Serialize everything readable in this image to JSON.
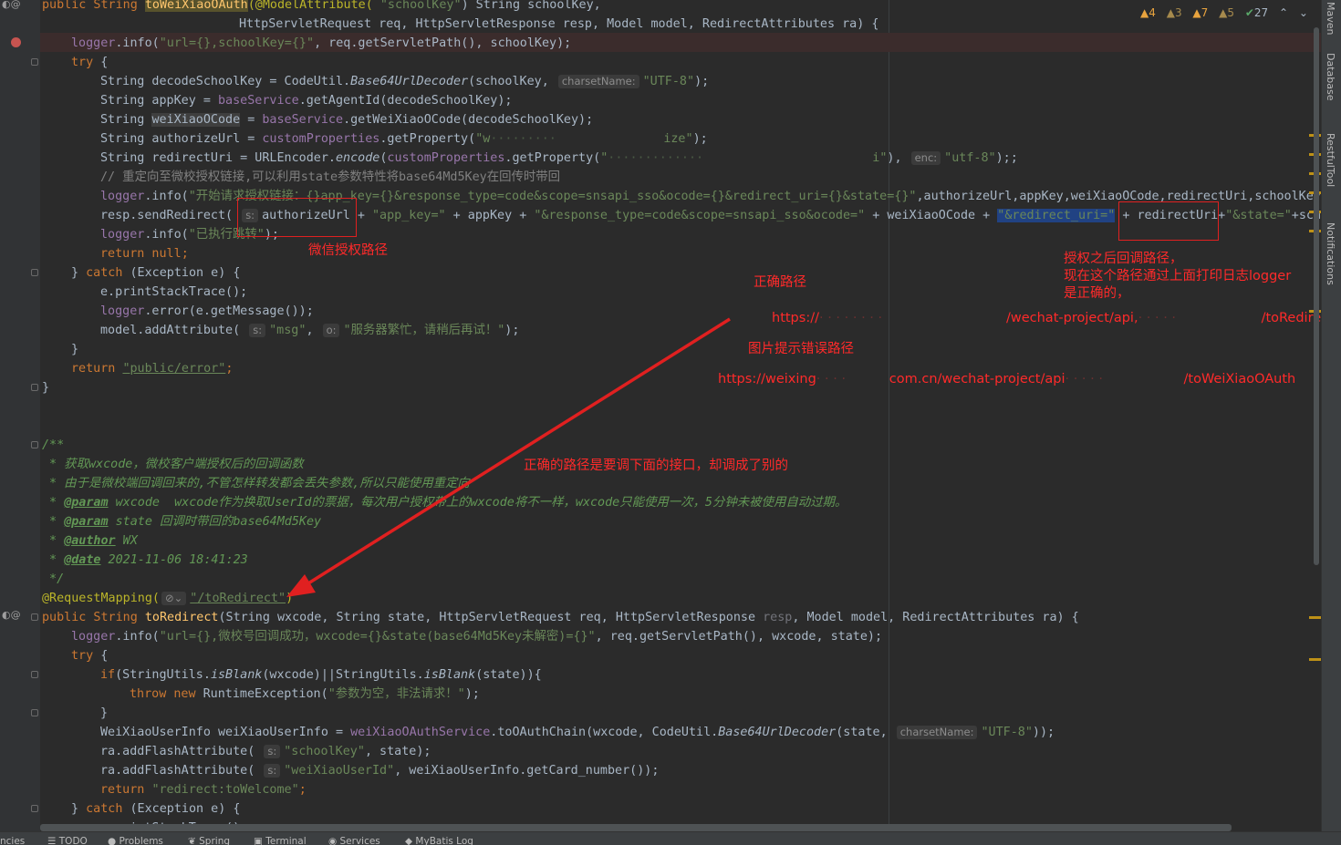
{
  "inspections": {
    "warn1": "4",
    "warn2": "3",
    "warn3": "7",
    "warn4": "5",
    "ok": "27",
    "up": "⌃",
    "down": "⌄"
  },
  "right_tabs": [
    "Maven",
    "Database",
    "RestfulTool",
    "Notifications"
  ],
  "status_items": [
    "ncies",
    "TODO",
    "Problems",
    "Spring",
    "Terminal",
    "Services",
    "MyBatis Log"
  ],
  "code": {
    "l1": {
      "a": "public String ",
      "b": "toWeiXiaoOAuth",
      "c": "(@ModelAttribute( ",
      "d": "\"schoolKey\"",
      "e": ") String schoolKey,"
    },
    "l2": {
      "a": "HttpServletRequest req, HttpServletResponse resp, Model model, RedirectAttributes ra) {"
    },
    "l3": {
      "a": "logger",
      "b": ".info(",
      "c": "\"url={},schoolKey={}\"",
      "d": ", req.getServletPath(), schoolKey);"
    },
    "l4": {
      "a": "try",
      "b": " {"
    },
    "l5": {
      "a": "String decodeSchoolKey = CodeUtil.",
      "b": "Base64UrlDecoder",
      "c": "(schoolKey, ",
      "h": "charsetName:",
      "d": "\"UTF-8\"",
      "e": ");"
    },
    "l6": {
      "a": "String appKey = ",
      "b": "baseService",
      "c": ".getAgentId(decodeSchoolKey);"
    },
    "l7": {
      "a": "String ",
      "b": "weiXiaoOCode",
      "c": " = ",
      "d": "baseService",
      "e": ".getWeiXiaoOCode(decodeSchoolKey);"
    },
    "l8": {
      "a": "String authorizeUrl = ",
      "b": "customProperties",
      "c": ".getProperty(",
      "d": "\"w",
      "e": "ize\"",
      "f": ");"
    },
    "l9": {
      "a": "String redirectUri = URLEncoder.",
      "b": "encode",
      "c": "(",
      "d": "customProperties",
      "e": ".getProperty(",
      "f": "\"",
      "g": "i\"",
      "j": "), ",
      "h": "enc:",
      "k": "\"utf-8\"",
      "m": ");;"
    },
    "l10": {
      "a": "// 重定向至微校授权链接,可以利用state参数特性将base64Md5Key在回传时带回"
    },
    "l11": {
      "a": "logger",
      "b": ".info(",
      "c": "\"开始请求授权链接：{}app_key={}&response_type=code&scope=snsapi_sso&ocode={}&redirect_uri={}&state={}\"",
      "d": ",authorizeUrl,appKey,weiXiaoOCode,redirectUri,schoolKey);"
    },
    "l12": {
      "a": "resp.sendRedirect( ",
      "h": "s:",
      "b": "authorizeUrl + ",
      "c": "\"app_key=\"",
      "d": " + appKey + ",
      "e": "\"&response_type=code&scope=snsapi_sso&ocode=\"",
      "f": " + weiXiaoOCode + ",
      "g": "\"&redirect_uri=\"",
      "i": " + ",
      "j": "redirectUri+",
      "k": "\"&state=\"",
      "m": "+school"
    },
    "l13": {
      "a": "logger",
      "b": ".info(",
      "c": "\"已执行跳转\"",
      "d": ");"
    },
    "l14": {
      "a": "return null",
      "b": ";"
    },
    "l15": {
      "a": "} ",
      "b": "catch",
      "c": " (Exception e) {"
    },
    "l16": {
      "a": "e.printStackTrace();"
    },
    "l17": {
      "a": "logger",
      "b": ".error(e.getMessage());"
    },
    "l18": {
      "a": "model.addAttribute( ",
      "h1": "s:",
      "b": "\"msg\"",
      "c": ", ",
      "h2": "o:",
      "d": "\"服务器繁忙，请稍后再试！\"",
      "e": ");"
    },
    "l19": {
      "a": "}"
    },
    "l20": {
      "a": "return ",
      "b": "\"public/error\"",
      "c": ";"
    },
    "l21": {
      "a": "}"
    },
    "l24": {
      "a": "/**"
    },
    "l25": {
      "a": " * 获取wxcode，微校客户端授权后的回调函数"
    },
    "l26": {
      "a": " * 由于是微校端回调回来的,不管怎样转发都会丢失参数,所以只能使用重定向"
    },
    "l27": {
      "a": " * ",
      "b": "@param",
      "c": " wxcode  wxcode作为换取UserId的票据，每次用户授权带上的wxcode将不一样，wxcode只能使用一次，5分钟未被使用自动过期。"
    },
    "l28": {
      "a": " * ",
      "b": "@param",
      "c": " state 回调时带回的base64Md5Key"
    },
    "l29": {
      "a": " * ",
      "b": "@author",
      "c": " WX"
    },
    "l30": {
      "a": " * ",
      "b": "@date",
      "c": " 2021-11-06 18:41:23"
    },
    "l31": {
      "a": " */"
    },
    "l32": {
      "a": "@RequestMapping(",
      "b": "\"/toRedirect\"",
      "c": ")"
    },
    "l33": {
      "a": "public String ",
      "b": "toRedirect",
      "c": "(String wxcode, String state, HttpServletRequest req, HttpServletResponse ",
      "d": "resp",
      "e": ", Model model, RedirectAttributes ra) {"
    },
    "l34": {
      "a": "logger",
      "b": ".info(",
      "c": "\"url={},微校号回调成功，wxcode={}&state(base64Md5Key未解密)={}\"",
      "d": ", req.getServletPath(), wxcode, state);"
    },
    "l35": {
      "a": "try",
      "b": " {"
    },
    "l36": {
      "a": "if",
      "b": "(StringUtils.",
      "c": "isBlank",
      "d": "(wxcode)||StringUtils.",
      "e": "isBlank",
      "f": "(state)){"
    },
    "l37": {
      "a": "throw new ",
      "b": "RuntimeException(",
      "c": "\"参数为空，非法请求！\"",
      "d": ");"
    },
    "l38": {
      "a": "}"
    },
    "l39": {
      "a": "WeiXiaoUserInfo weiXiaoUserInfo = ",
      "b": "weiXiaoOAuthService",
      "c": ".toOAuthChain(wxcode, CodeUtil.",
      "d": "Base64UrlDecoder",
      "e": "(state, ",
      "h": "charsetName:",
      "f": "\"UTF-8\"",
      "g": "));"
    },
    "l40": {
      "a": "ra.addFlashAttribute( ",
      "h": "s:",
      "b": "\"schoolKey\"",
      "c": ", state);"
    },
    "l41": {
      "a": "ra.addFlashAttribute( ",
      "h": "s:",
      "b": "\"weiXiaoUserId\"",
      "c": ", weiXiaoUserInfo.getCard_number());"
    },
    "l42": {
      "a": "return ",
      "b": "\"redirect:toWelcome\"",
      "c": ";"
    },
    "l43": {
      "a": "} ",
      "b": "catch",
      "c": " (Exception e) {"
    },
    "l44": {
      "a": "e.printStackTrace();"
    }
  },
  "notes": {
    "wechat_path": "微信授权路径",
    "callback": "授权之后回调路径，\n现在这个路径通过上面打印日志logger\n是正确的，",
    "correct_path": "正确路径",
    "correct_url_a": "https://",
    "correct_url_b": "/wechat-project/api,",
    "correct_url_c": "/toRedirect",
    "error_path": "图片提示错误路径",
    "error_url_a": "https://weixing",
    "error_url_b": "com.cn/wechat-project/api",
    "error_url_c": "/toWeiXiaoOAuth",
    "explain": "正确的路径是要调下面的接口，却调成了别的"
  }
}
